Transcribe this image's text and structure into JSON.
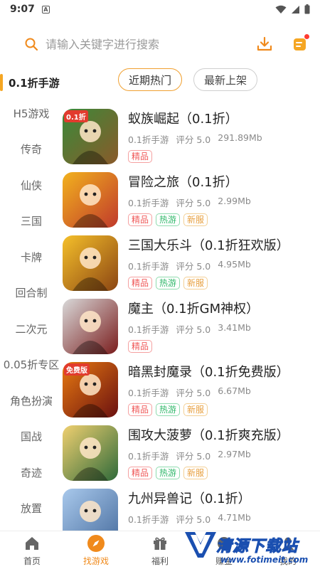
{
  "status_bar": {
    "time": "9:07",
    "sim_label": "A"
  },
  "search": {
    "placeholder": "请输入关键字进行搜索"
  },
  "sidebar": {
    "items": [
      {
        "label": "0.1折手游",
        "active": true
      },
      {
        "label": "H5游戏"
      },
      {
        "label": "传奇"
      },
      {
        "label": "仙侠"
      },
      {
        "label": "三国"
      },
      {
        "label": "卡牌"
      },
      {
        "label": "回合制"
      },
      {
        "label": "二次元"
      },
      {
        "label": "0.05折专区"
      },
      {
        "label": "角色扮演"
      },
      {
        "label": "国战"
      },
      {
        "label": "奇迹"
      },
      {
        "label": "放置"
      }
    ]
  },
  "tabs": [
    {
      "label": "近期热门",
      "active": true
    },
    {
      "label": "最新上架"
    }
  ],
  "games": [
    {
      "title": "蚁族崛起（0.1折）",
      "category": "0.1折手游",
      "rating": "评分 5.0",
      "size": "291.89Mb",
      "tags": [
        "精品"
      ],
      "icon_badge": "0.1折",
      "colors": [
        "#3a8a3a",
        "#8a5a2a"
      ]
    },
    {
      "title": "冒险之旅（0.1折）",
      "category": "0.1折手游",
      "rating": "评分 5.0",
      "size": "2.99Mb",
      "tags": [
        "精品",
        "热游",
        "新服"
      ],
      "icon_badge": "",
      "colors": [
        "#f2b21e",
        "#c0392b"
      ]
    },
    {
      "title": "三国大乐斗（0.1折狂欢版）",
      "category": "0.1折手游",
      "rating": "评分 5.0",
      "size": "4.95Mb",
      "tags": [
        "精品",
        "热游",
        "新服"
      ],
      "icon_badge": "",
      "colors": [
        "#f5c02a",
        "#8b4513"
      ]
    },
    {
      "title": "魔主（0.1折GM神权）",
      "category": "0.1折手游",
      "rating": "评分 5.0",
      "size": "3.41Mb",
      "tags": [
        "精品"
      ],
      "icon_badge": "",
      "colors": [
        "#d9d9d9",
        "#7a1d1d"
      ]
    },
    {
      "title": "暗黑封魔录（0.1折免费版）",
      "category": "0.1折手游",
      "rating": "评分 5.0",
      "size": "6.67Mb",
      "tags": [
        "精品",
        "热游",
        "新服"
      ],
      "icon_badge": "免费版",
      "colors": [
        "#e87a10",
        "#6a1010"
      ]
    },
    {
      "title": "围攻大菠萝（0.1折爽充版）",
      "category": "0.1折手游",
      "rating": "评分 5.0",
      "size": "2.97Mb",
      "tags": [
        "精品",
        "热游",
        "新服"
      ],
      "icon_badge": "",
      "colors": [
        "#f0d070",
        "#2f6a3a"
      ]
    },
    {
      "title": "九州异兽记（0.1折）",
      "category": "0.1折手游",
      "rating": "评分 5.0",
      "size": "4.71Mb",
      "tags": [],
      "icon_badge": "",
      "colors": [
        "#a9c9ec",
        "#4a6fa0"
      ]
    }
  ],
  "bottom_nav": [
    {
      "label": "首页",
      "icon": "home-icon"
    },
    {
      "label": "找游戏",
      "icon": "compass-icon",
      "active": true
    },
    {
      "label": "福利",
      "icon": "gift-icon"
    },
    {
      "label": "赚金",
      "icon": "coin-icon"
    },
    {
      "label": "我的",
      "icon": "user-icon"
    }
  ],
  "watermark": {
    "title": "清源下载站",
    "url": "www.fotimeit.com"
  },
  "accent_color": "#f5a623"
}
